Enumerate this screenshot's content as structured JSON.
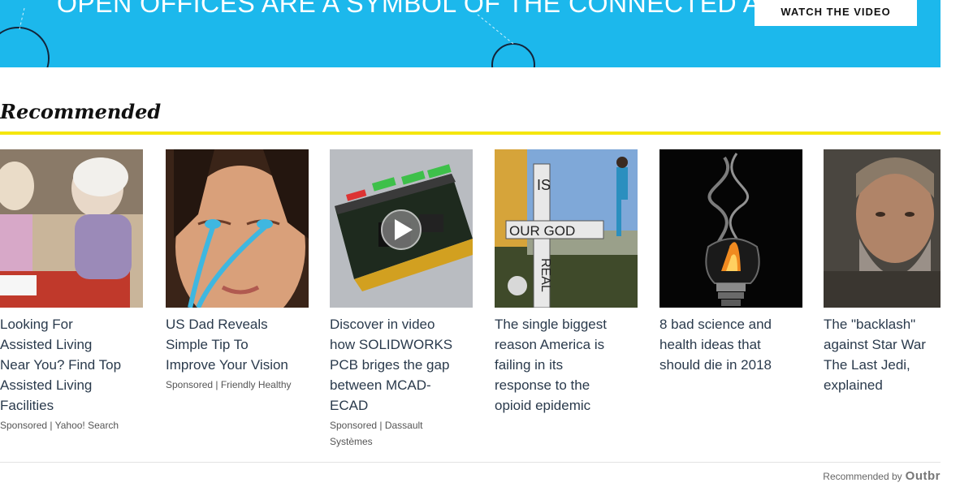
{
  "banner": {
    "headline": "OPEN OFFICES ARE A SYMBOL OF THE CONNECTED AGE",
    "cta_label": "WATCH THE VIDEO"
  },
  "section": {
    "title": "Recommended"
  },
  "cards": [
    {
      "title_lines": [
        "Looking For",
        "Assisted Living",
        "Near You? Find Top",
        "Assisted Living",
        "Facilities"
      ],
      "source": "Sponsored | Yahoo! Search"
    },
    {
      "title_lines": [
        "US Dad Reveals",
        "Simple Tip To",
        "Improve Your Vision"
      ],
      "source": "Sponsored | Friendly Healthy"
    },
    {
      "title_lines": [
        "Discover in video",
        "how SOLIDWORKS",
        "PCB briges the gap",
        "between MCAD-",
        "ECAD"
      ],
      "source_lines": [
        "Sponsored | Dassault",
        "Systèmes"
      ]
    },
    {
      "title_lines": [
        "The single biggest",
        "reason America is",
        "failing in its",
        "response to the",
        "opioid epidemic"
      ],
      "image_text": [
        "IS",
        "OUR GOD",
        "REAL"
      ]
    },
    {
      "title_lines": [
        "8 bad science and",
        "health ideas that",
        "should die in 2018"
      ]
    },
    {
      "title_lines": [
        "The \"backlash\"",
        "against Star War",
        "The Last Jedi,",
        "explained"
      ]
    }
  ],
  "footer": {
    "credit_prefix": "Recommended by",
    "credit_brand": "Outbr"
  },
  "colors": {
    "banner": "#1cb8ec",
    "rule": "#f5e60f",
    "title_text": "#2a3a4c"
  }
}
